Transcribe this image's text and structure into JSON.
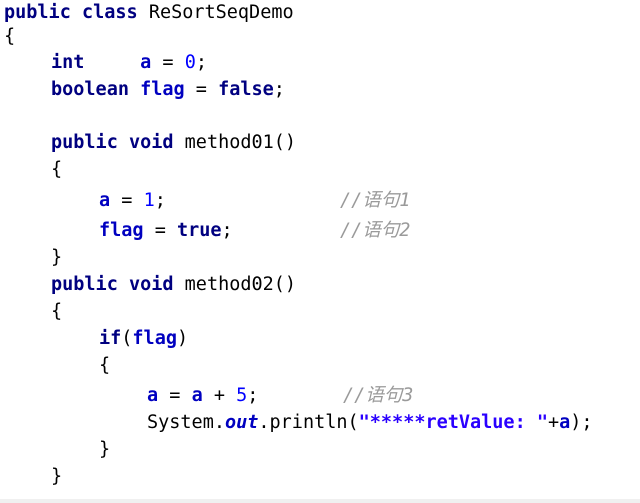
{
  "code": {
    "l1": {
      "kw1": "public",
      "kw2": "class",
      "name": "ReSortSeqDemo"
    },
    "l2": {
      "brace": "{"
    },
    "l3": {
      "type": "int",
      "var": "a",
      "op": " = ",
      "val": "0",
      "semi": ";"
    },
    "l4": {
      "type": "boolean",
      "var": "flag",
      "op": " = ",
      "val": "false",
      "semi": ";"
    },
    "l6": {
      "kw1": "public",
      "kw2": "void",
      "name": "method01()"
    },
    "l7": {
      "brace": "{"
    },
    "l8": {
      "var": "a",
      "op": " = ",
      "val": "1",
      "semi": ";",
      "comment": "//语句1"
    },
    "l9": {
      "var": "flag",
      "op": " = ",
      "val": "true",
      "semi": ";",
      "comment": "//语句2"
    },
    "l10": {
      "brace": "}"
    },
    "l11": {
      "kw1": "public",
      "kw2": "void",
      "name": "method02()"
    },
    "l12": {
      "brace": "{"
    },
    "l13": {
      "kw": "if",
      "open": "(",
      "var": "flag",
      "close": ")"
    },
    "l14": {
      "brace": "{"
    },
    "l15": {
      "var1": "a",
      "op1": " = ",
      "var2": "a",
      "op2": " + ",
      "val": "5",
      "semi": ";",
      "comment": "//语句3"
    },
    "l16": {
      "cls": "System.",
      "field": "out",
      "call": ".println(",
      "str": "\"*****retValue: \"",
      "plus": "+",
      "var": "a",
      "end": ");"
    },
    "l17": {
      "brace": "}"
    },
    "l18": {
      "brace": "}"
    }
  }
}
